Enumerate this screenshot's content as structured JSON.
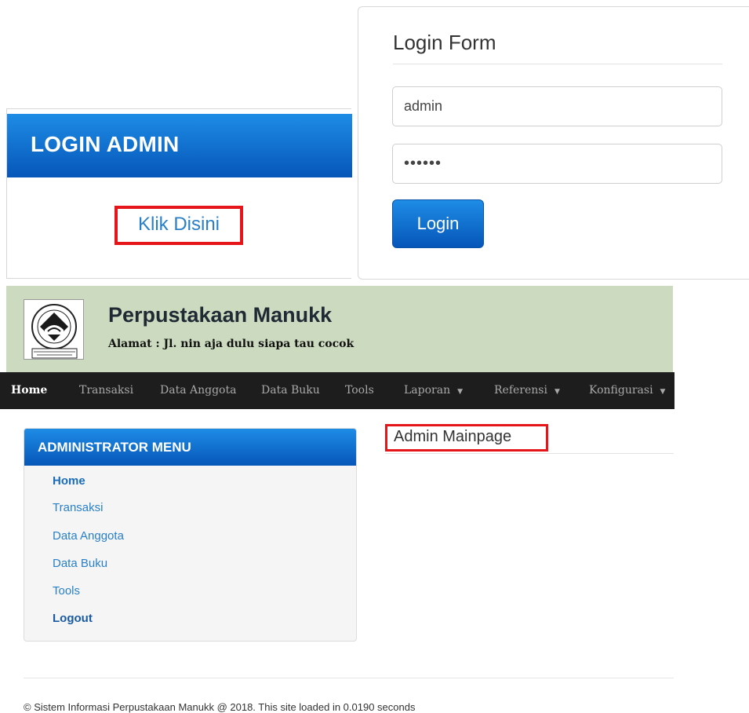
{
  "login_admin": {
    "heading": "LOGIN ADMIN",
    "link_label": "Klik Disini"
  },
  "login_form": {
    "title": "Login Form",
    "username_value": "admin",
    "password_value": "••••••",
    "login_button": "Login"
  },
  "site": {
    "title": "Perpustakaan Manukk",
    "address": "Alamat : Jl. nin aja dulu siapa tau cocok",
    "logo_icon": "school-emblem-icon"
  },
  "navbar": {
    "items": [
      {
        "label": "Home",
        "active": true,
        "dropdown": false
      },
      {
        "label": "Transaksi",
        "active": false,
        "dropdown": false
      },
      {
        "label": "Data Anggota",
        "active": false,
        "dropdown": false
      },
      {
        "label": "Data Buku",
        "active": false,
        "dropdown": false
      },
      {
        "label": "Tools",
        "active": false,
        "dropdown": false
      },
      {
        "label": "Laporan",
        "active": false,
        "dropdown": true
      },
      {
        "label": "Referensi",
        "active": false,
        "dropdown": true
      },
      {
        "label": "Konfigurasi",
        "active": false,
        "dropdown": true
      }
    ]
  },
  "admin_menu": {
    "heading": "ADMINISTRATOR MENU",
    "items": [
      {
        "label": "Home"
      },
      {
        "label": "Transaksi"
      },
      {
        "label": "Data Anggota"
      },
      {
        "label": "Data Buku"
      },
      {
        "label": "Tools"
      },
      {
        "label": "Logout"
      }
    ]
  },
  "main": {
    "title": "Admin Mainpage"
  },
  "footer": {
    "text": "© Sistem Informasi Perpustakaan Manukk @ 2018. This site loaded in 0.0190 seconds"
  },
  "colors": {
    "accent_blue": "#0656b8",
    "highlight_red": "#e5151a",
    "header_bg": "#ccdbbf",
    "navbar_bg": "#1d1d1d"
  }
}
